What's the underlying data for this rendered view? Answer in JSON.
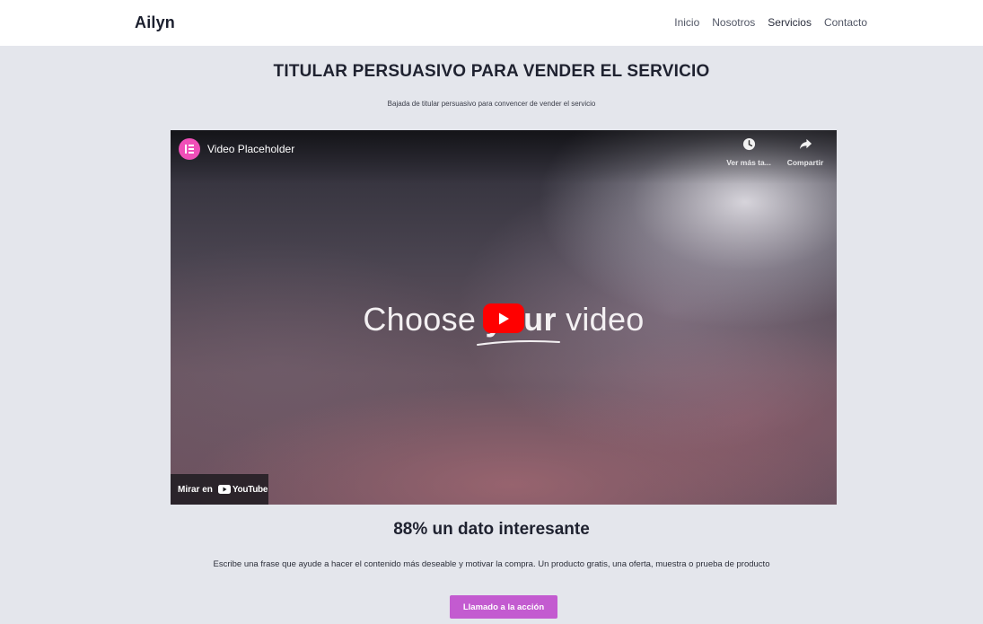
{
  "header": {
    "logo": "Ailyn",
    "nav": [
      {
        "label": "Inicio"
      },
      {
        "label": "Nosotros"
      },
      {
        "label": "Servicios"
      },
      {
        "label": "Contacto"
      }
    ]
  },
  "hero": {
    "title": "TITULAR PERSUASIVO PARA VENDER EL SERVICIO",
    "subtitle": "Bajada de titular persuasivo para convencer de vender el servicio"
  },
  "video": {
    "title": "Video Placeholder",
    "watch_later_label": "Ver más ta...",
    "share_label": "Compartir",
    "overlay_text_before": "Choose ",
    "overlay_text_bold": "your",
    "overlay_text_after": " video",
    "watch_on_label": "Mirar en",
    "youtube_wordmark": "YouTube",
    "icons": [
      "elementor-icon",
      "clock-icon",
      "share-icon",
      "play-icon",
      "youtube-logo-icon"
    ]
  },
  "stat": {
    "title": "88% un dato interesante",
    "description": "Escribe una frase que ayude a hacer el contenido más deseable y motivar la compra. Un producto gratis, una oferta, muestra o prueba de producto"
  },
  "cta": {
    "label": "Llamado a la acción"
  },
  "colors": {
    "background": "#e4e6ec",
    "header": "#ffffff",
    "cta": "#c35bd0",
    "avatar": "#f04fb8",
    "youtube_red": "#ff0000"
  }
}
